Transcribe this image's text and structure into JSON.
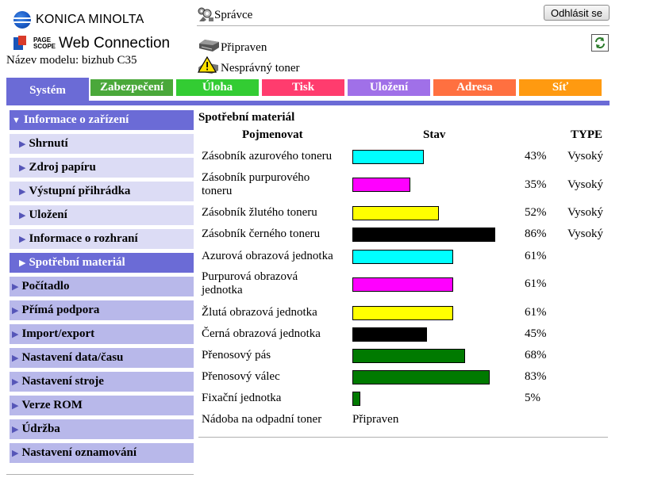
{
  "brand": {
    "maker_logo": "KONICA MINOLTA",
    "pagescope_logo": "PAGE SCOPE",
    "product": "Web Connection",
    "model_label": "Název modelu: bizhub C35"
  },
  "header": {
    "user": "Správce",
    "logout": "Odhlásit se",
    "status_ready": "Připraven",
    "status_warning": "Nesprávný toner"
  },
  "tabs": [
    {
      "label": "Systém",
      "color": "#6b6bd6"
    },
    {
      "label": "Zabezpečení",
      "color": "#4aa83a"
    },
    {
      "label": "Úloha",
      "color": "#33cc33"
    },
    {
      "label": "Tisk",
      "color": "#ff3c6e"
    },
    {
      "label": "Uložení",
      "color": "#a070e8"
    },
    {
      "label": "Adresa",
      "color": "#ff7040"
    },
    {
      "label": "Síť",
      "color": "#ff9a10"
    }
  ],
  "sidebar": [
    {
      "label": "Informace o zařízení",
      "level": 0,
      "state": "open"
    },
    {
      "label": "Shrnutí",
      "level": 1,
      "state": ""
    },
    {
      "label": "Zdroj papíru",
      "level": 1,
      "state": ""
    },
    {
      "label": "Výstupní přihrádka",
      "level": 1,
      "state": ""
    },
    {
      "label": "Uložení",
      "level": 1,
      "state": ""
    },
    {
      "label": "Informace o rozhraní",
      "level": 1,
      "state": ""
    },
    {
      "label": "Spotřební materiál",
      "level": 1,
      "state": "selected"
    },
    {
      "label": "Počítadlo",
      "level": 0,
      "state": ""
    },
    {
      "label": "Přímá podpora",
      "level": 0,
      "state": ""
    },
    {
      "label": "Import/export",
      "level": 0,
      "state": ""
    },
    {
      "label": "Nastavení data/času",
      "level": 0,
      "state": ""
    },
    {
      "label": "Nastavení stroje",
      "level": 0,
      "state": ""
    },
    {
      "label": "Verze ROM",
      "level": 0,
      "state": ""
    },
    {
      "label": "Údržba",
      "level": 0,
      "state": ""
    },
    {
      "label": "Nastavení oznamování",
      "level": 0,
      "state": ""
    }
  ],
  "main": {
    "title": "Spotřební materiál",
    "col_name": "Pojmenovat",
    "col_status": "Stav",
    "col_type": "TYPE",
    "rows": [
      {
        "name": "Zásobník azurového toneru",
        "percent": 43,
        "percent_label": "43%",
        "type": "Vysoký",
        "color": "#00ffff"
      },
      {
        "name": "Zásobník purpurového toneru",
        "percent": 35,
        "percent_label": "35%",
        "type": "Vysoký",
        "color": "#ff00ff"
      },
      {
        "name": "Zásobník žlutého toneru",
        "percent": 52,
        "percent_label": "52%",
        "type": "Vysoký",
        "color": "#ffff00"
      },
      {
        "name": "Zásobník černého toneru",
        "percent": 86,
        "percent_label": "86%",
        "type": "Vysoký",
        "color": "#000000"
      },
      {
        "name": "Azurová obrazová jednotka",
        "percent": 61,
        "percent_label": "61%",
        "type": "",
        "color": "#00ffff"
      },
      {
        "name": "Purpurová obrazová jednotka",
        "percent": 61,
        "percent_label": "61%",
        "type": "",
        "color": "#ff00ff"
      },
      {
        "name": "Žlutá obrazová jednotka",
        "percent": 61,
        "percent_label": "61%",
        "type": "",
        "color": "#ffff00"
      },
      {
        "name": "Černá obrazová jednotka",
        "percent": 45,
        "percent_label": "45%",
        "type": "",
        "color": "#000000"
      },
      {
        "name": "Přenosový pás",
        "percent": 68,
        "percent_label": "68%",
        "type": "",
        "color": "#007a00"
      },
      {
        "name": "Přenosový válec",
        "percent": 83,
        "percent_label": "83%",
        "type": "",
        "color": "#007a00"
      },
      {
        "name": "Fixační jednotka",
        "percent": 5,
        "percent_label": "5%",
        "type": "",
        "color": "#007a00"
      }
    ],
    "waste": {
      "name": "Nádoba na odpadní toner",
      "status": "Připraven"
    }
  }
}
